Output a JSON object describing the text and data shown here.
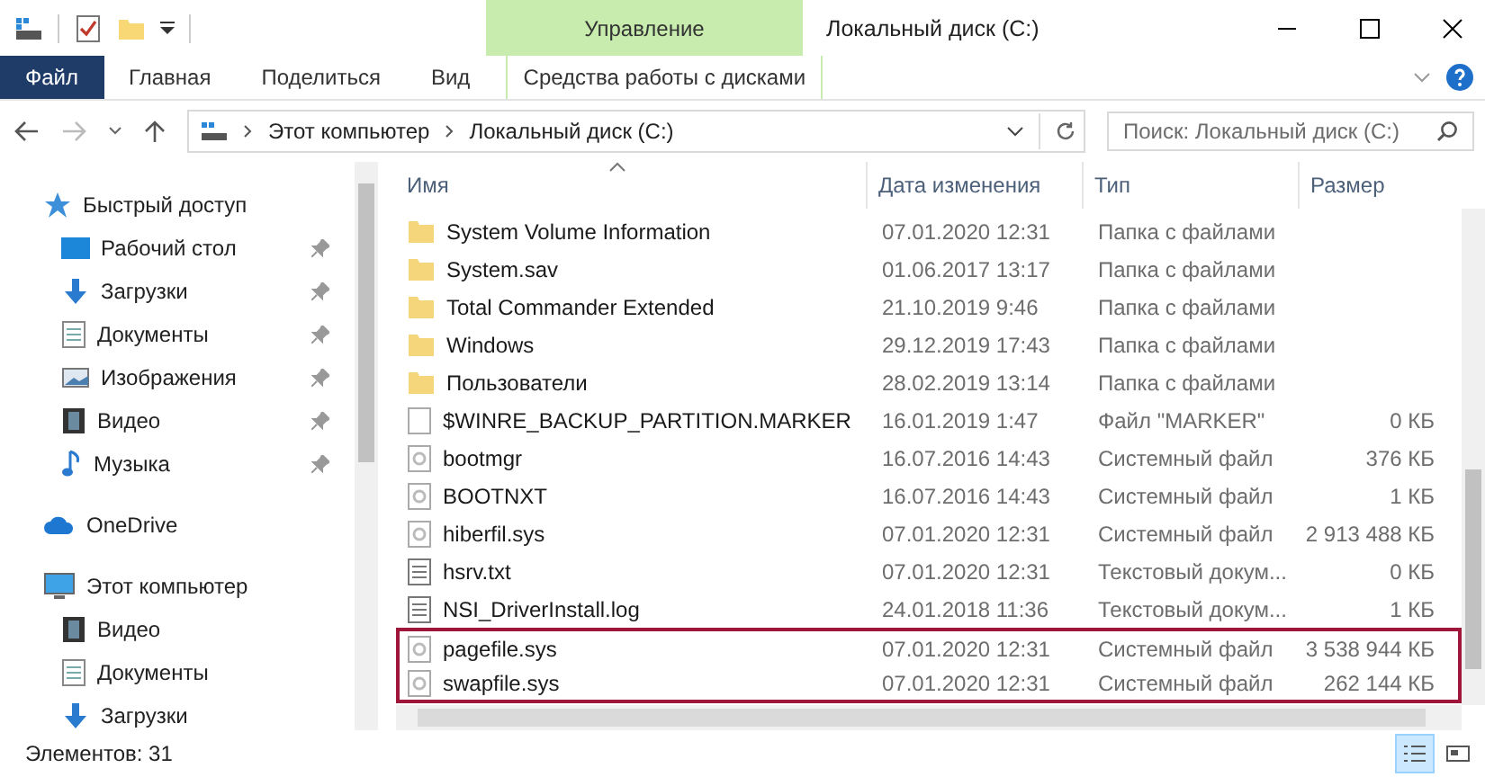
{
  "window": {
    "title": "Локальный диск (C:)",
    "context_tab": "Управление"
  },
  "ribbon_tabs": [
    {
      "label": "Файл",
      "selected": false,
      "kind": "file"
    },
    {
      "label": "Главная",
      "selected": false,
      "kind": "plain"
    },
    {
      "label": "Поделиться",
      "selected": false,
      "kind": "plain"
    },
    {
      "label": "Вид",
      "selected": false,
      "kind": "plain"
    },
    {
      "label": "Средства работы с дисками",
      "selected": false,
      "kind": "context"
    }
  ],
  "address": {
    "crumbs": [
      "Этот компьютер",
      "Локальный диск (C:)"
    ]
  },
  "search": {
    "placeholder": "Поиск: Локальный диск (C:)"
  },
  "sidebar": {
    "items": [
      {
        "label": "Быстрый доступ",
        "kind": "star",
        "children": [
          {
            "label": "Рабочий стол",
            "kind": "desktop",
            "pinned": true
          },
          {
            "label": "Загрузки",
            "kind": "download",
            "pinned": true
          },
          {
            "label": "Документы",
            "kind": "document",
            "pinned": true
          },
          {
            "label": "Изображения",
            "kind": "image",
            "pinned": true
          },
          {
            "label": "Видео",
            "kind": "video",
            "pinned": true
          },
          {
            "label": "Музыка",
            "kind": "music",
            "pinned": true
          }
        ]
      },
      {
        "label": "OneDrive",
        "kind": "cloud"
      },
      {
        "label": "Этот компьютер",
        "kind": "computer",
        "children": [
          {
            "label": "Видео",
            "kind": "video",
            "pinned": false
          },
          {
            "label": "Документы",
            "kind": "document",
            "pinned": false
          },
          {
            "label": "Загрузки",
            "kind": "download",
            "pinned": false
          }
        ]
      }
    ]
  },
  "table": {
    "columns": [
      "Имя",
      "Дата изменения",
      "Тип",
      "Размер"
    ],
    "rows": [
      {
        "name": "System Volume Information",
        "date": "07.01.2020 12:31",
        "type": "Папка с файлами",
        "size": "",
        "kind": "folder",
        "highlighted": false
      },
      {
        "name": "System.sav",
        "date": "01.06.2017 13:17",
        "type": "Папка с файлами",
        "size": "",
        "kind": "folder",
        "highlighted": false
      },
      {
        "name": "Total Commander Extended",
        "date": "21.10.2019 9:46",
        "type": "Папка с файлами",
        "size": "",
        "kind": "folder",
        "highlighted": false
      },
      {
        "name": "Windows",
        "date": "29.12.2019 17:43",
        "type": "Папка с файлами",
        "size": "",
        "kind": "folder",
        "highlighted": false
      },
      {
        "name": "Пользователи",
        "date": "28.02.2019 13:14",
        "type": "Папка с файлами",
        "size": "",
        "kind": "folder",
        "highlighted": false
      },
      {
        "name": "$WINRE_BACKUP_PARTITION.MARKER",
        "date": "16.01.2019 1:47",
        "type": "Файл \"MARKER\"",
        "size": "0 КБ",
        "kind": "file",
        "highlighted": false
      },
      {
        "name": "bootmgr",
        "date": "16.07.2016 14:43",
        "type": "Системный файл",
        "size": "376 КБ",
        "kind": "system",
        "highlighted": false
      },
      {
        "name": "BOOTNXT",
        "date": "16.07.2016 14:43",
        "type": "Системный файл",
        "size": "1 КБ",
        "kind": "system",
        "highlighted": false
      },
      {
        "name": "hiberfil.sys",
        "date": "07.01.2020 12:31",
        "type": "Системный файл",
        "size": "2 913 488 КБ",
        "kind": "system",
        "highlighted": false
      },
      {
        "name": "hsrv.txt",
        "date": "07.01.2020 12:31",
        "type": "Текстовый докум...",
        "size": "0 КБ",
        "kind": "text",
        "highlighted": false
      },
      {
        "name": "NSI_DriverInstall.log",
        "date": "24.01.2018 11:36",
        "type": "Текстовый докум...",
        "size": "1 КБ",
        "kind": "text",
        "highlighted": false
      },
      {
        "name": "pagefile.sys",
        "date": "07.01.2020 12:31",
        "type": "Системный файл",
        "size": "3 538 944 КБ",
        "kind": "system",
        "highlighted": true
      },
      {
        "name": "swapfile.sys",
        "date": "07.01.2020 12:31",
        "type": "Системный файл",
        "size": "262 144 КБ",
        "kind": "system",
        "highlighted": true
      }
    ]
  },
  "status_bar": {
    "count": "Элементов: 31"
  },
  "view_buttons": [
    {
      "kind": "details",
      "selected": true
    },
    {
      "kind": "tiles",
      "selected": false
    }
  ]
}
